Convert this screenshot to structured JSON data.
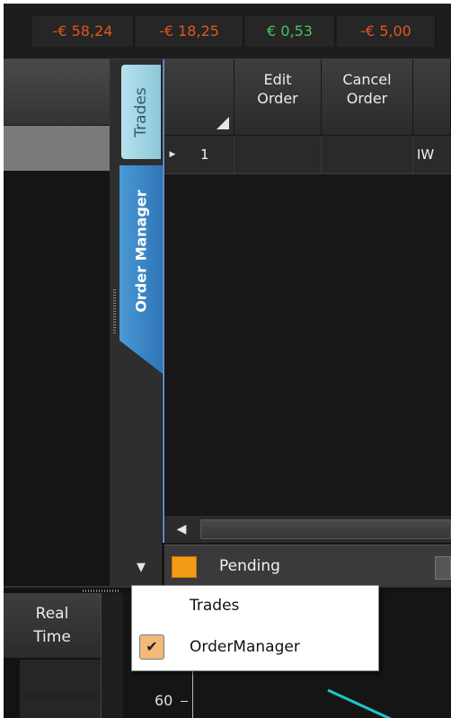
{
  "pnl_bar": {
    "values": [
      {
        "text": "-€ 58,24",
        "color": "#e0561f"
      },
      {
        "text": "-€ 18,25",
        "color": "#e0561f"
      },
      {
        "text": "€ 0,53",
        "color": "#4cc25a"
      },
      {
        "text": "-€ 5,00",
        "color": "#e0561f"
      }
    ]
  },
  "side_tabs": {
    "trades": "Trades",
    "order_manager": "Order Manager"
  },
  "grid": {
    "columns": [
      "",
      "Edit\nOrder",
      "Cancel\nOrder",
      ""
    ],
    "rows": [
      {
        "index": "1",
        "edit": "",
        "cancel": "",
        "symbol": "IW"
      }
    ]
  },
  "status": {
    "label": "Pending",
    "swatch_color": "#f39a18"
  },
  "bottom_panel": {
    "real_time_header": "Real\nTime",
    "y_tick": "60"
  },
  "context_menu": {
    "items": [
      {
        "label": "Trades",
        "checked": false
      },
      {
        "label": "OrderManager",
        "checked": true
      }
    ]
  },
  "colors": {
    "negative": "#e0561f",
    "positive": "#4cc25a",
    "accent_blue": "#3a86c8",
    "chart_line": "#1fc7c7"
  }
}
